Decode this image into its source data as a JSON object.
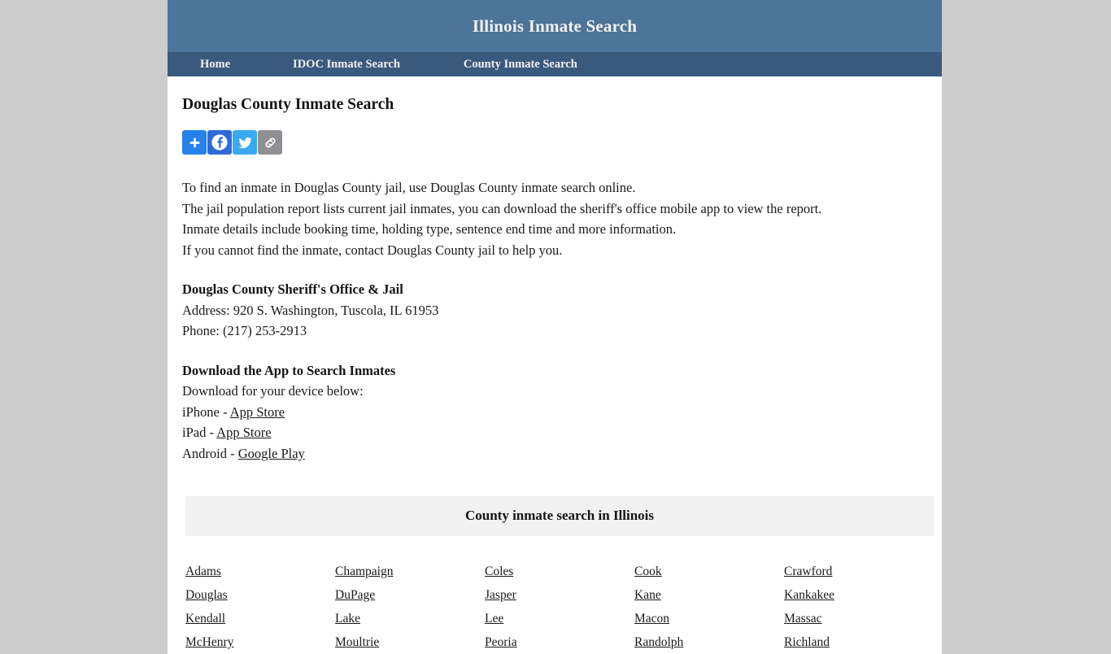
{
  "header": {
    "site_title": "Illinois Inmate Search",
    "bg_color": "#4d7499"
  },
  "nav": {
    "bg_color": "#3a5a7d",
    "items": [
      {
        "label": "Home"
      },
      {
        "label": "IDOC Inmate Search"
      },
      {
        "label": "County Inmate Search"
      }
    ]
  },
  "main": {
    "page_title": "Douglas County Inmate Search",
    "share": {
      "buttons": [
        {
          "name": "addthis-share-button",
          "icon": "plus-icon",
          "color": "#2681e8"
        },
        {
          "name": "facebook-share-button",
          "icon": "facebook-icon",
          "color": "#2f6bd8"
        },
        {
          "name": "twitter-share-button",
          "icon": "twitter-icon",
          "color": "#3aa9f0"
        },
        {
          "name": "copy-link-button",
          "icon": "link-icon",
          "color": "#8f9094"
        }
      ]
    },
    "intro_lines": [
      "To find an inmate in Douglas County jail, use Douglas County inmate search online.",
      "The jail population report lists current jail inmates, you can download the sheriff's office mobile app to view the report.",
      "Inmate details include booking time, holding type, sentence end time and more information.",
      "If you cannot find the inmate, contact Douglas County jail to help you."
    ],
    "office": {
      "heading": "Douglas County Sheriff's Office & Jail",
      "address": "Address: 920 S. Washington, Tuscola, IL 61953",
      "phone": "Phone: (217) 253-2913"
    },
    "download": {
      "heading": "Download the App to Search Inmates",
      "subtitle": "Download for your device below:",
      "rows": [
        {
          "prefix": "iPhone - ",
          "link": "App Store"
        },
        {
          "prefix": "iPad - ",
          "link": "App Store"
        },
        {
          "prefix": "Android - ",
          "link": "Google Play"
        }
      ]
    },
    "county_table": {
      "title": "County inmate search in Illinois",
      "header_bg": "#f1f1f1",
      "rows": [
        [
          "Adams",
          "Champaign",
          "Coles",
          "Cook",
          "Crawford"
        ],
        [
          "Douglas",
          "DuPage",
          "Jasper",
          "Kane",
          "Kankakee"
        ],
        [
          "Kendall",
          "Lake",
          "Lee",
          "Macon",
          "Massac"
        ],
        [
          "McHenry",
          "Moultrie",
          "Peoria",
          "Randolph",
          "Richland"
        ]
      ]
    }
  }
}
